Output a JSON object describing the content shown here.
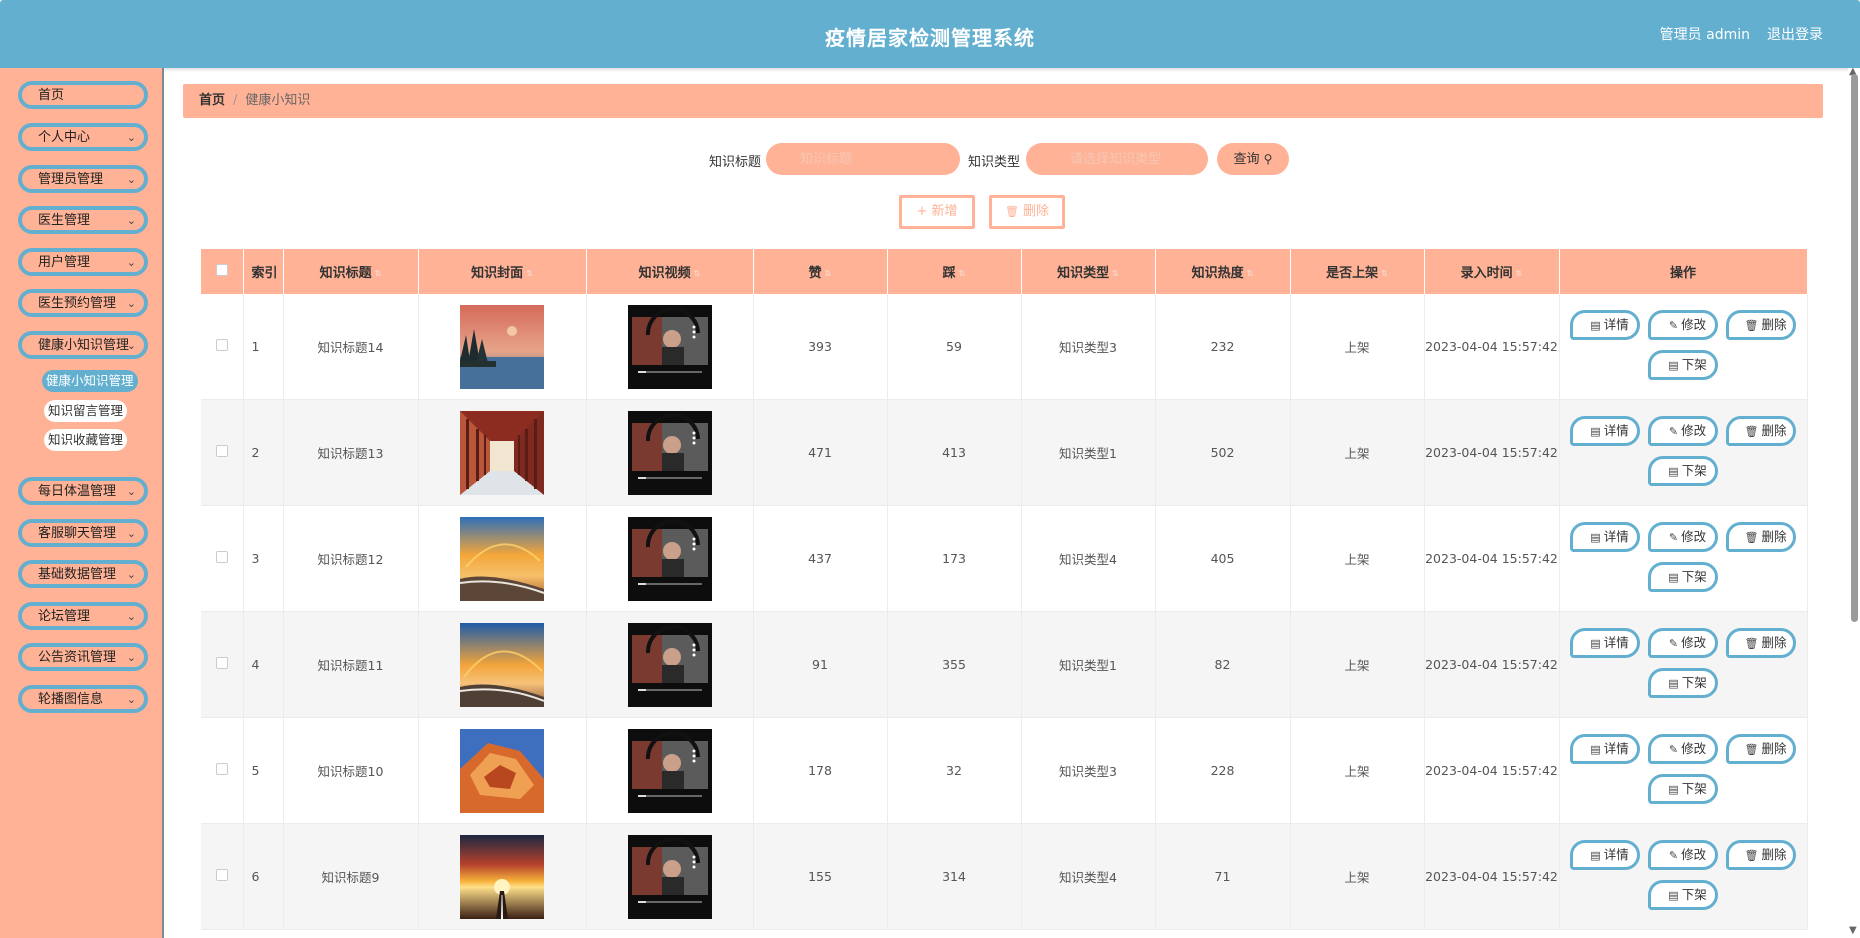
{
  "header": {
    "title": "疫情居家检测管理系统",
    "admin_label": "管理员 admin",
    "logout_label": "退出登录"
  },
  "sidebar": {
    "items": [
      {
        "label": "首页",
        "expandable": false
      },
      {
        "label": "个人中心",
        "expandable": true
      },
      {
        "label": "管理员管理",
        "expandable": true
      },
      {
        "label": "医生管理",
        "expandable": true
      },
      {
        "label": "用户管理",
        "expandable": true
      },
      {
        "label": "医生预约管理",
        "expandable": true
      },
      {
        "label": "健康小知识管理",
        "expandable": true
      },
      {
        "label": "每日体温管理",
        "expandable": true
      },
      {
        "label": "客服聊天管理",
        "expandable": true
      },
      {
        "label": "基础数据管理",
        "expandable": true
      },
      {
        "label": "论坛管理",
        "expandable": true
      },
      {
        "label": "公告资讯管理",
        "expandable": true
      },
      {
        "label": "轮播图信息",
        "expandable": true
      }
    ],
    "submenu": [
      {
        "label": "健康小知识管理",
        "active": true
      },
      {
        "label": "知识留言管理",
        "active": false
      },
      {
        "label": "知识收藏管理",
        "active": false
      }
    ]
  },
  "breadcrumb": {
    "home": "首页",
    "separator": "/",
    "current": "健康小知识"
  },
  "search": {
    "title_label": "知识标题",
    "title_placeholder": "知识标题",
    "type_label": "知识类型",
    "type_placeholder": "请选择知识类型",
    "query_label": "查询"
  },
  "actions": {
    "add_label": "+ 新增",
    "delete_label": "删除"
  },
  "table": {
    "headers": [
      "索引",
      "知识标题",
      "知识封面",
      "知识视频",
      "赞",
      "踩",
      "知识类型",
      "知识热度",
      "是否上架",
      "录入时间",
      "操作"
    ],
    "rows": [
      {
        "index": "1",
        "title": "知识标题14",
        "cover": "lake-sunset",
        "likes": "393",
        "dislikes": "59",
        "type": "知识类型3",
        "heat": "232",
        "status": "上架",
        "time": "2023-04-04 15:57:42"
      },
      {
        "index": "2",
        "title": "知识标题13",
        "cover": "corridor",
        "likes": "471",
        "dislikes": "413",
        "type": "知识类型1",
        "heat": "502",
        "status": "上架",
        "time": "2023-04-04 15:57:42"
      },
      {
        "index": "3",
        "title": "知识标题12",
        "cover": "beach-rainbow",
        "likes": "437",
        "dislikes": "173",
        "type": "知识类型4",
        "heat": "405",
        "status": "上架",
        "time": "2023-04-04 15:57:42"
      },
      {
        "index": "4",
        "title": "知识标题11",
        "cover": "beach-rainbow-2",
        "likes": "91",
        "dislikes": "355",
        "type": "知识类型1",
        "heat": "82",
        "status": "上架",
        "time": "2023-04-04 15:57:42"
      },
      {
        "index": "5",
        "title": "知识标题10",
        "cover": "red-rock",
        "likes": "178",
        "dislikes": "32",
        "type": "知识类型3",
        "heat": "228",
        "status": "上架",
        "time": "2023-04-04 15:57:42"
      },
      {
        "index": "6",
        "title": "知识标题9",
        "cover": "road-sunset",
        "likes": "155",
        "dislikes": "314",
        "type": "知识类型4",
        "heat": "71",
        "status": "上架",
        "time": "2023-04-04 15:57:42"
      }
    ],
    "op_labels": {
      "detail": "详情",
      "edit": "修改",
      "delete": "删除",
      "offshelf": "下架"
    }
  },
  "colors": {
    "header": "#62afd0",
    "accent": "#ffb296",
    "button_border": "#62afd0"
  }
}
